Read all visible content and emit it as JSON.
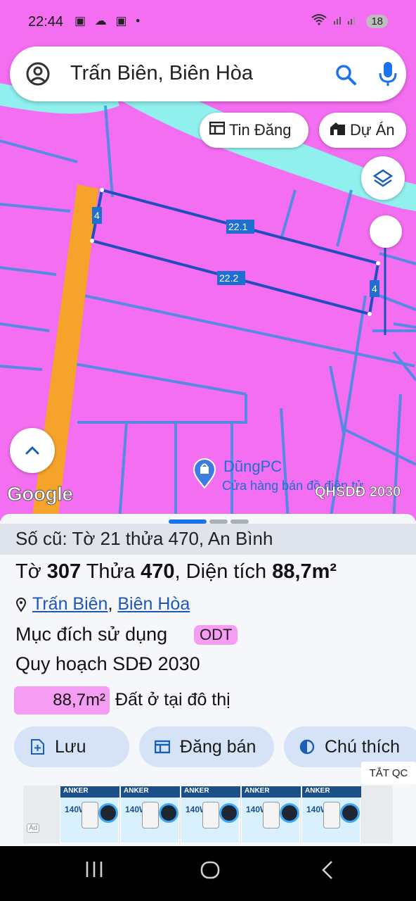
{
  "status_bar": {
    "time": "22:44",
    "battery": "18"
  },
  "search": {
    "query": "Trấn Biên, Biên Hòa"
  },
  "map": {
    "chips": {
      "tin_dang": "Tin Đăng",
      "du_an": "Dự Án"
    },
    "parcel_labels": {
      "left_width": "4",
      "top_length": "22.1",
      "bottom_length": "22.2",
      "right_width": "4"
    },
    "poi": {
      "name": "DũngPC",
      "subtitle": "Cửa hàng bán đồ điện tử"
    },
    "watermark": "Google",
    "layer_label": "QHSDĐ 2030",
    "colors": {
      "land": "#f36ef0",
      "road": "#f5a32a",
      "river": "#8ff0ee",
      "boundary": "#2f80d6",
      "parcel": "#1f4fbd"
    }
  },
  "sheet": {
    "old_record": "Số cũ: Tờ 21 thửa 470, An Bình",
    "sheet_prefix": "Tờ ",
    "sheet_no": "307",
    "parcel_prefix": " Thửa ",
    "parcel_no": "470",
    "area_prefix": ", Diện tích ",
    "area_value": "88,7m²",
    "location": {
      "ward": "Trấn Biên",
      "sep": ",",
      "city": "Biên Hòa"
    },
    "purpose_label": "Mục đích sử dụng",
    "purpose_code": "ODT",
    "plan_label": "Quy hoạch SDĐ 2030",
    "plan_area": "88,7m²",
    "plan_desc": "Đất ở tại đô thị",
    "actions": {
      "save": "Lưu",
      "post": "Đăng bán",
      "legend": "Chú thích"
    },
    "ads_off": "TẮT QC",
    "ad_brand": "ANKER",
    "ad_watt": "140W",
    "ad_mark": "Ad"
  }
}
